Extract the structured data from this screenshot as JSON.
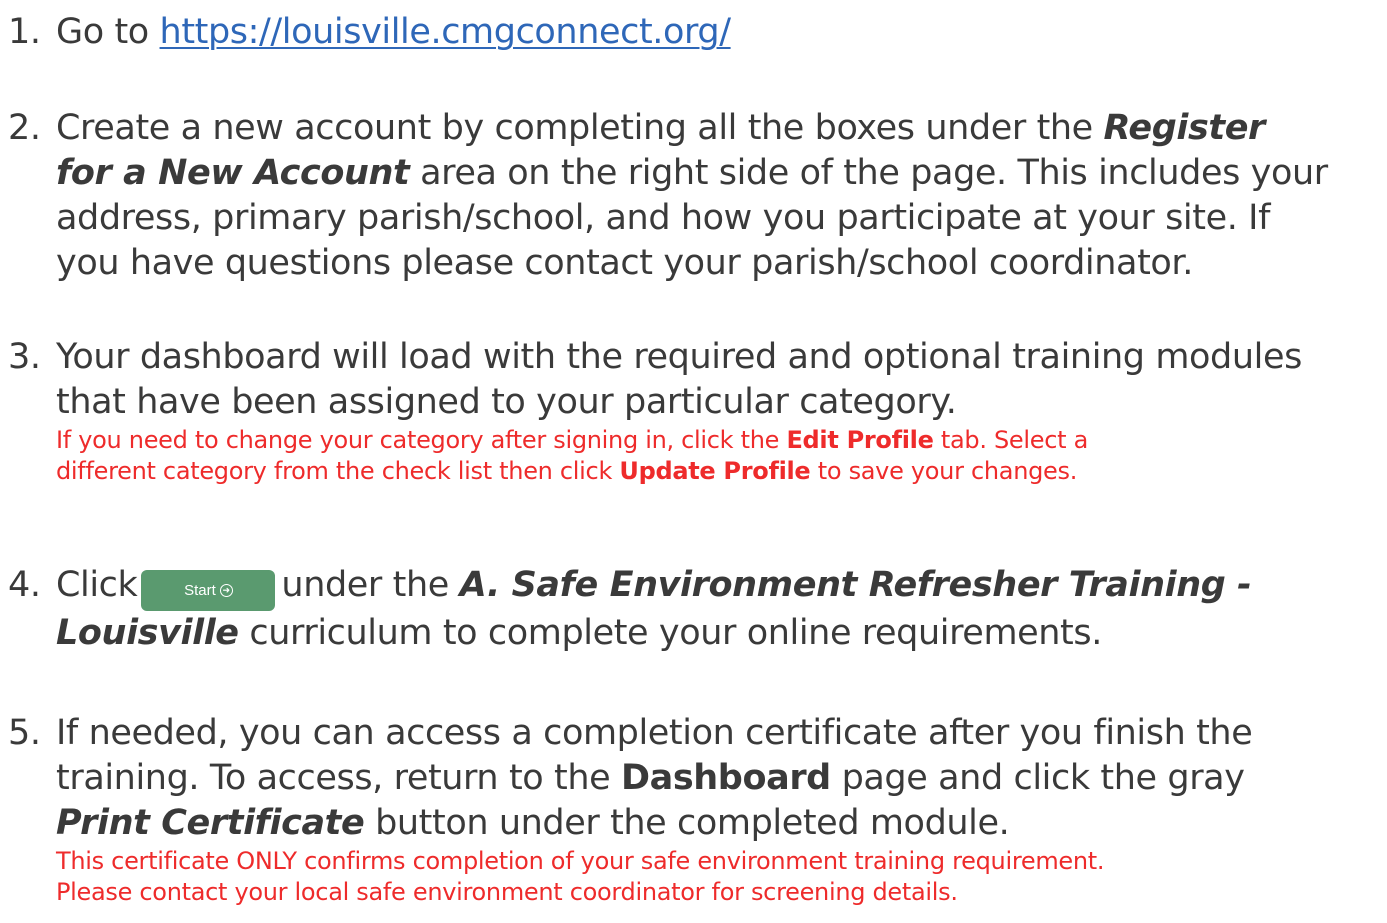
{
  "steps": {
    "s1": {
      "number": "1.",
      "prefix": "Go to ",
      "link": "https://louisville.cmgconnect.org/"
    },
    "s2": {
      "number": "2.",
      "l1_text": "Create a new account by completing all the boxes under the ",
      "l1_em": "Register",
      "l2_em": "for a New Account",
      "l2_text": " area on the right side of the page. This includes your",
      "l3": "address, primary parish/school, and how you participate at your site. If",
      "l4": "you have questions please contact your parish/school coordinator."
    },
    "s3": {
      "number": "3.",
      "l1": "Your dashboard will load with the required and optional training modules",
      "l2": "that have been assigned to your particular category.",
      "note_l1_a": "If you need to change your category after signing in, click the ",
      "note_l1_b": "Edit Profile",
      "note_l1_c": " tab. Select a",
      "note_l2_a": "different category from the check list then click ",
      "note_l2_b": "Update Profile",
      "note_l2_c": " to save your changes."
    },
    "s4": {
      "number": "4.",
      "l1_a": "Click",
      "button_label": "Start",
      "button_icon": "arrow-circle-right-icon",
      "l1_b": "under the ",
      "l1_em": "A. Safe Environment Refresher Training -",
      "l2_em": "Louisville",
      "l2_text": " curriculum to complete your online requirements."
    },
    "s5": {
      "number": "5.",
      "l1": "If needed, you can access a completion certificate after you finish the",
      "l2_a": "training. To access, return to the ",
      "l2_b": "Dashboard",
      "l2_c": " page and click the gray",
      "l3_em": "Print Certificate",
      "l3_text": " button under the completed module.",
      "note_l1": "This certificate ONLY confirms completion of your safe environment training requirement.",
      "note_l2": "Please contact your local safe environment coordinator for screening details."
    }
  },
  "colors": {
    "text": "#3a3a3a",
    "link": "#2e67b8",
    "note": "#ee2b2b",
    "button": "#5a9a6f"
  }
}
